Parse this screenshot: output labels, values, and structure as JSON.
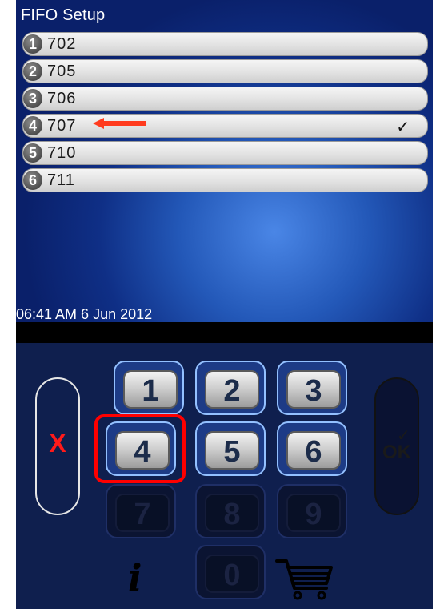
{
  "screen": {
    "title": "FIFO Setup",
    "datetime": "06:41 AM 6 Jun 2012",
    "items": [
      {
        "number": "1",
        "code": "702",
        "checked": false
      },
      {
        "number": "2",
        "code": "705",
        "checked": false
      },
      {
        "number": "3",
        "code": "706",
        "checked": false
      },
      {
        "number": "4",
        "code": "707",
        "checked": true,
        "check_mark": "✓"
      },
      {
        "number": "5",
        "code": "710",
        "checked": false
      },
      {
        "number": "6",
        "code": "711",
        "checked": false
      }
    ]
  },
  "keypad": {
    "keys": [
      "1",
      "2",
      "3",
      "4",
      "5",
      "6",
      "7",
      "8",
      "9",
      "0"
    ],
    "enabled_keys": [
      "1",
      "2",
      "3",
      "4",
      "5",
      "6"
    ],
    "highlighted_key": "4",
    "cancel_label": "X",
    "ok_label": "OK"
  },
  "icons": {
    "info": "i",
    "cart": "shopping-cart-icon",
    "arrow": "arrow-left-icon"
  },
  "colors": {
    "annotation": "#ff0000",
    "arrow": "#ff3b1e",
    "cancel": "#ff1a1a"
  }
}
